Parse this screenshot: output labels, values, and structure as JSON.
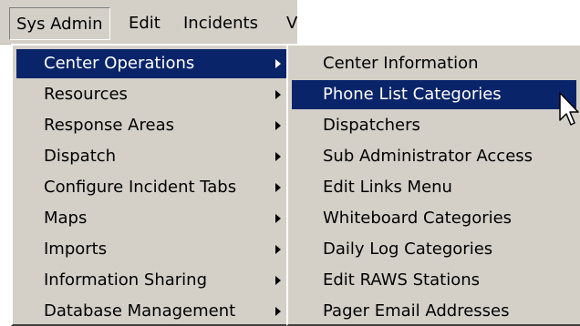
{
  "menubar": {
    "items": [
      {
        "label": "Sys Admin"
      },
      {
        "label": "Edit"
      },
      {
        "label": "Incidents"
      },
      {
        "label": "V"
      }
    ]
  },
  "main_menu": {
    "items": [
      {
        "label": "Center Operations"
      },
      {
        "label": "Resources"
      },
      {
        "label": "Response Areas"
      },
      {
        "label": "Dispatch"
      },
      {
        "label": "Configure Incident Tabs"
      },
      {
        "label": "Maps"
      },
      {
        "label": "Imports"
      },
      {
        "label": "Information Sharing"
      },
      {
        "label": "Database Management"
      }
    ],
    "selected": "Center Operations"
  },
  "sub_menu": {
    "items": [
      {
        "label": "Center Information"
      },
      {
        "label": "Phone List Categories"
      },
      {
        "label": "Dispatchers"
      },
      {
        "label": "Sub Administrator Access"
      },
      {
        "label": "Edit Links Menu"
      },
      {
        "label": "Whiteboard Categories"
      },
      {
        "label": "Daily Log Categories"
      },
      {
        "label": "Edit RAWS Stations"
      },
      {
        "label": "Pager Email Addresses"
      }
    ],
    "selected": "Phone List Categories"
  },
  "colors": {
    "menu_face": "#d4d0c8",
    "highlight": "#0a246a",
    "highlight_text": "#ffffff"
  },
  "cursor": {
    "icon": "arrow-cursor-icon"
  }
}
